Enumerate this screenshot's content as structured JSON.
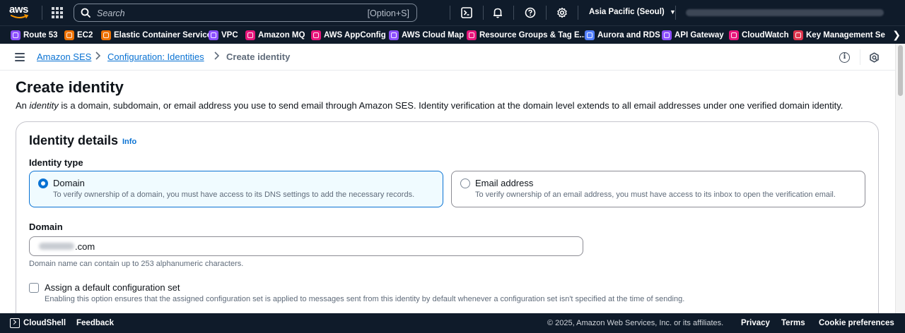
{
  "topnav": {
    "logo_text": "aws",
    "search_placeholder": "Search",
    "search_shortcut": "[Option+S]",
    "region": "Asia Pacific (Seoul)",
    "icons": [
      "cloudshell-icon",
      "bell-icon",
      "help-icon",
      "gear-icon"
    ]
  },
  "favorites": [
    {
      "label": "Route 53",
      "color": "#8c4fff"
    },
    {
      "label": "EC2",
      "color": "#ed7100"
    },
    {
      "label": "Elastic Container Service",
      "color": "#ed7100"
    },
    {
      "label": "VPC",
      "color": "#8c4fff"
    },
    {
      "label": "Amazon MQ",
      "color": "#e7157b"
    },
    {
      "label": "AWS AppConfig",
      "color": "#e7157b"
    },
    {
      "label": "AWS Cloud Map",
      "color": "#8c4fff"
    },
    {
      "label": "Resource Groups & Tag E...",
      "color": "#e7157b"
    },
    {
      "label": "Aurora and RDS",
      "color": "#527fff"
    },
    {
      "label": "API Gateway",
      "color": "#8c4fff"
    },
    {
      "label": "CloudWatch",
      "color": "#e7157b"
    },
    {
      "label": "Key Management Se",
      "color": "#dd344c"
    }
  ],
  "breadcrumb": {
    "items": [
      "Amazon SES",
      "Configuration: Identities"
    ],
    "current": "Create identity"
  },
  "page": {
    "title": "Create identity",
    "desc_prefix": "An ",
    "desc_em": "identity",
    "desc_suffix": " is a domain, subdomain, or email address you use to send email through Amazon SES. Identity verification at the domain level extends to all email addresses under one verified domain identity."
  },
  "identity_details": {
    "title": "Identity details",
    "info": "Info",
    "type_label": "Identity type",
    "options": [
      {
        "name": "Domain",
        "desc": "To verify ownership of a domain, you must have access to its DNS settings to add the necessary records.",
        "selected": true
      },
      {
        "name": "Email address",
        "desc": "To verify ownership of an email address, you must have access to its inbox to open the verification email.",
        "selected": false
      }
    ],
    "domain_label": "Domain",
    "domain_value": ".com",
    "domain_hint": "Domain name can contain up to 253 alphanumeric characters.",
    "config_set_label": "Assign a default configuration set",
    "config_set_desc": "Enabling this option ensures that the assigned configuration set is applied to messages sent from this identity by default whenever a configuration set isn't specified at the time of sending.",
    "config_set_checked": false
  },
  "footer": {
    "cloudshell": "CloudShell",
    "feedback": "Feedback",
    "copyright": "© 2025, Amazon Web Services, Inc. or its affiliates.",
    "privacy": "Privacy",
    "terms": "Terms",
    "cookies": "Cookie preferences"
  }
}
